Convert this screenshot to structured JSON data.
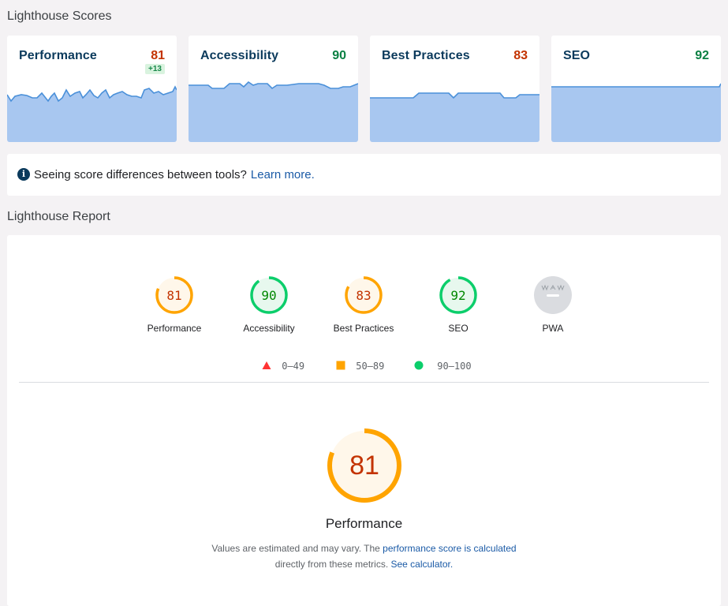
{
  "scores_section": {
    "title": "Lighthouse Scores"
  },
  "cards": [
    {
      "name": "Performance",
      "score": "81",
      "delta": "+13",
      "color": "#c33300"
    },
    {
      "name": "Accessibility",
      "score": "90",
      "color": "#0b8043"
    },
    {
      "name": "Best Practices",
      "score": "83",
      "color": "#c33300"
    },
    {
      "name": "SEO",
      "score": "92",
      "color": "#0b8043"
    }
  ],
  "notice": {
    "icon": "info-icon",
    "text": "Seeing score differences between tools?",
    "link": "Learn more."
  },
  "report_section": {
    "title": "Lighthouse Report"
  },
  "gauges": [
    {
      "label": "Performance",
      "value": "81",
      "fraction": 0.81,
      "status": "average"
    },
    {
      "label": "Accessibility",
      "value": "90",
      "fraction": 0.9,
      "status": "pass"
    },
    {
      "label": "Best Practices",
      "value": "83",
      "fraction": 0.83,
      "status": "average"
    },
    {
      "label": "SEO",
      "value": "92",
      "fraction": 0.92,
      "status": "pass"
    },
    {
      "label": "PWA",
      "value": "",
      "status": "na"
    }
  ],
  "legend": [
    {
      "icon": "triangle-icon",
      "range": "0–49",
      "color": "#ff3333"
    },
    {
      "icon": "square-icon",
      "range": "50–89",
      "color": "#ffa400"
    },
    {
      "icon": "circle-icon",
      "range": "90–100",
      "color": "#0cce6b"
    }
  ],
  "main_gauge": {
    "value": "81",
    "fraction": 0.81,
    "title": "Performance",
    "desc_text_1": "Values are estimated and may vary. The ",
    "desc_link_1": "performance score is calculated",
    "desc_text_2": "directly from these metrics. ",
    "desc_link_2": "See calculator."
  },
  "colors": {
    "average_ring": "#ffa400",
    "average_fill": "#fff7ea",
    "average_text": "#c33300",
    "pass_ring": "#0cce6b",
    "pass_fill": "#e7f8ee",
    "pass_text": "#008800",
    "spark_fill": "#a8c7f0",
    "spark_line": "#4a90d9"
  }
}
